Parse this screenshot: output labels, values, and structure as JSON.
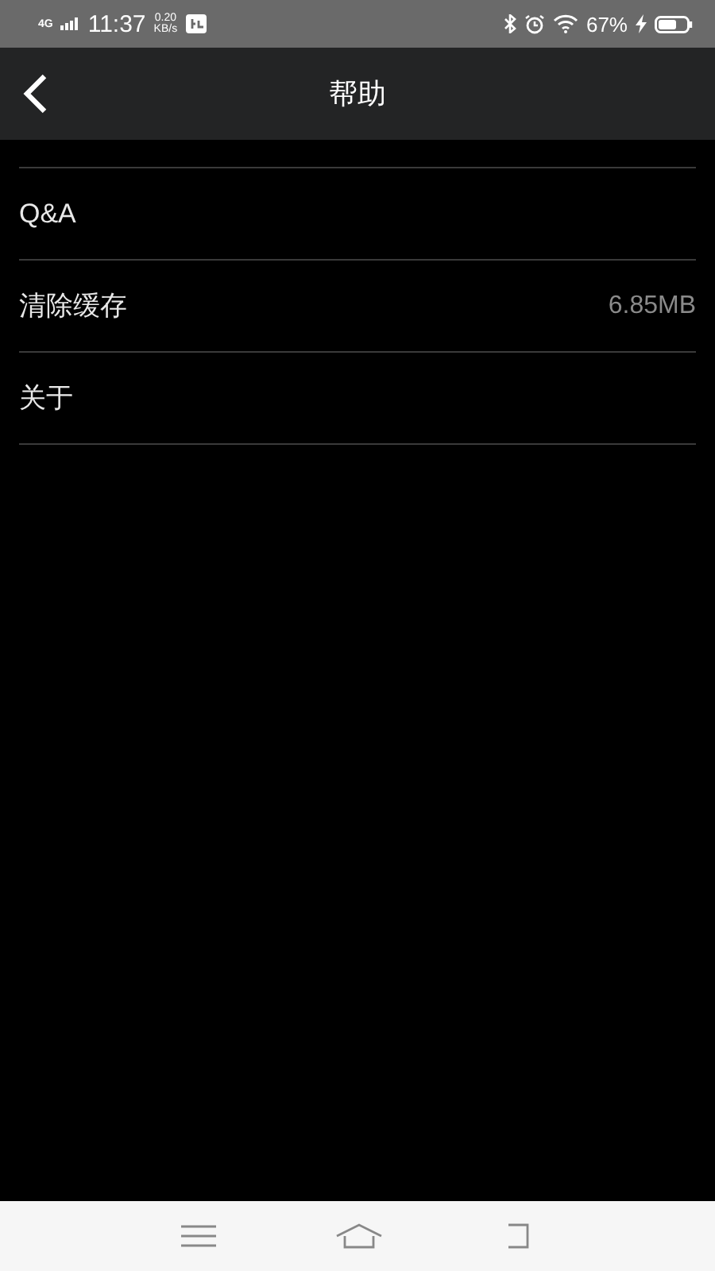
{
  "status_bar": {
    "network": "4G",
    "time": "11:37",
    "speed_value": "0.20",
    "speed_unit": "KB/s",
    "battery": "67%",
    "charging": true
  },
  "header": {
    "title": "帮助"
  },
  "items": [
    {
      "label": "Q&A"
    },
    {
      "label": "清除缓存",
      "value": "6.85MB"
    },
    {
      "label": "关于"
    }
  ]
}
